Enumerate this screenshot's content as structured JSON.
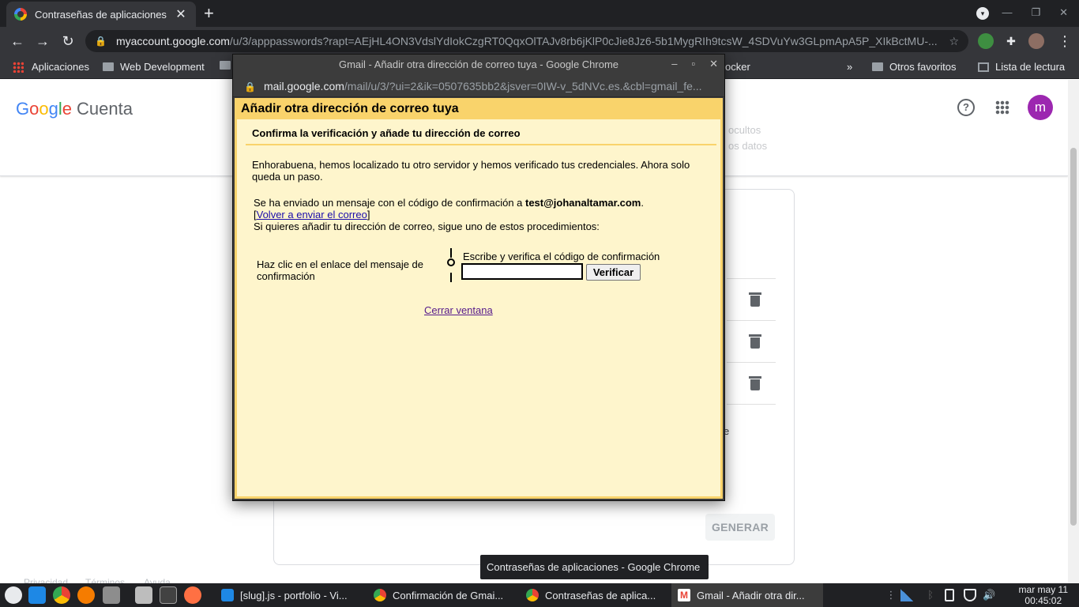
{
  "browser": {
    "tab_title": "Contraseñas de aplicaciones",
    "tab_close": "✕",
    "new_tab": "+",
    "url_host": "myaccount.google.com",
    "url_path": "/u/3/apppasswords?rapt=AEjHL4ON3VdslYdIokCzgRT0QqxOlTAJv8rb6jKlP0cJie8Jz6-5b1MygRIh9tcsW_4SDVuYw3GLpmApA5P_XIkBctMU-...",
    "bookmarks": {
      "apps": "Aplicaciones",
      "web_dev": "Web Development",
      "docker_fragment": "ocker",
      "more": "»",
      "otros_favoritos": "Otros favoritos",
      "lista_lectura": "Lista de lectura"
    }
  },
  "account_page": {
    "logo_google": [
      "G",
      "o",
      "o",
      "g",
      "l",
      "e"
    ],
    "logo_product": "Cuenta",
    "avatar_letter": "m",
    "help_glyph": "?",
    "generate_button": "GENERAR",
    "faded_right_1": "ocultos",
    "faded_right_2": "os datos",
    "faded_e": "e",
    "footer": [
      "Privacidad",
      "Términos",
      "Ayuda"
    ]
  },
  "popup": {
    "window_title": "Gmail - Añadir otra dirección de correo tuya - Google Chrome",
    "url_host": "mail.google.com",
    "url_path": "/mail/u/3/?ui=2&ik=0507635bb2&jsver=0IW-v_5dNVc.es.&cbl=gmail_fe...",
    "heading": "Añadir otra dirección de correo tuya",
    "subheading": "Confirma la verificación y añade tu dirección de correo",
    "success_text": "Enhorabuena, hemos localizado tu otro servidor y hemos verificado tus credenciales. Ahora solo queda un paso.",
    "sent_prefix": "Se ha enviado un mensaje con el código de confirmación a ",
    "sent_email": "test@johanaltamar.com",
    "sent_suffix": ".",
    "resend_link": "Volver a enviar el correo",
    "instructions": "Si quieres añadir tu dirección de correo, sigue uno de estos procedimientos:",
    "option_click": "Haz clic en el enlace del mensaje de confirmación",
    "option_code": "Escribe y verifica el código de confirmación",
    "code_value": "",
    "verify_button": "Verificar",
    "close_link": "Cerrar ventana"
  },
  "tooltip": "Contraseñas de aplicaciones - Google Chrome",
  "taskbar": {
    "tasks": [
      "[slug].js - portfolio - Vi...",
      "Confirmación de Gmai...",
      "Contraseñas de aplica...",
      "Gmail - Añadir otra dir..."
    ],
    "date": "mar may 11",
    "time": "00:45:02"
  },
  "colors": {
    "popup_bg": "#fef5cc",
    "popup_header": "#f9d36b",
    "avatar": "#9c27b0",
    "chrome_dark": "#35363a"
  }
}
